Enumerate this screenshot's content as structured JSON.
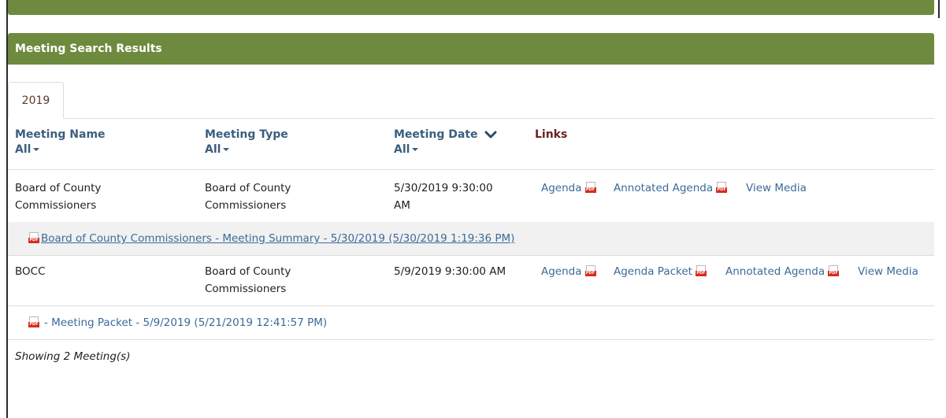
{
  "panel": {
    "title": "Meeting Search Results"
  },
  "tabs": [
    {
      "label": "2019",
      "active": true
    }
  ],
  "columns": {
    "name": {
      "title": "Meeting Name",
      "filter": "All"
    },
    "type": {
      "title": "Meeting Type",
      "filter": "All"
    },
    "date": {
      "title": "Meeting Date",
      "filter": "All",
      "sort": "descending"
    },
    "links": {
      "title": "Links"
    }
  },
  "rows": [
    {
      "name_line1": "Board of County",
      "name_line2": "Commissioners",
      "type_line1": "Board of County",
      "type_line2": "Commissioners",
      "date_line1": "5/30/2019 9:30:00",
      "date_line2": "AM",
      "links": [
        "Agenda",
        "Annotated Agenda",
        "View Media"
      ],
      "attachment": "Board of County Commissioners - Meeting Summary - 5/30/2019 (5/30/2019 1:19:36 PM)"
    },
    {
      "name_line1": "BOCC",
      "type_line1": "Board of County",
      "type_line2": "Commissioners",
      "date_line1": "5/9/2019 9:30:00 AM",
      "links": [
        "Agenda",
        "Agenda Packet",
        "Annotated Agenda",
        "View Media"
      ],
      "attachment": "- Meeting Packet - 5/9/2019 (5/21/2019 12:41:57 PM)"
    }
  ],
  "footer": "Showing 2 Meeting(s)",
  "icons": {
    "document": "pdf-icon",
    "sort": "chevron-down-icon",
    "filter": "caret-down-icon"
  },
  "colors": {
    "header_bg": "#6e8a3e",
    "link": "#3b6a9a",
    "column_header": "#3b5e7f",
    "links_header": "#6a1f1f",
    "pdf_badge": "#d62d1f"
  }
}
